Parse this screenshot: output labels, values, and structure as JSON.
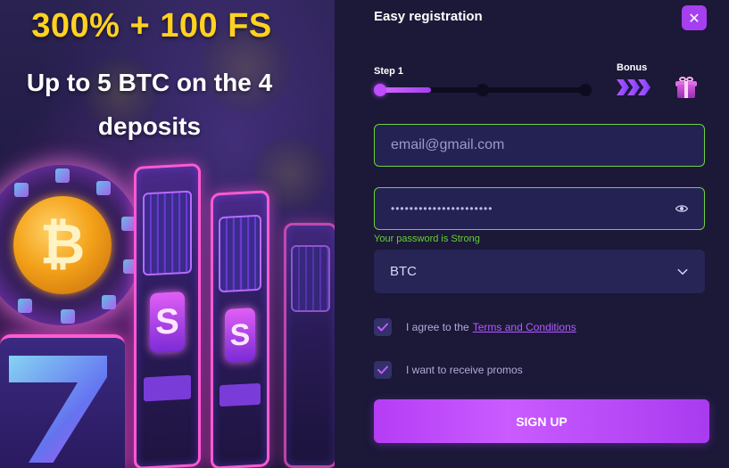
{
  "promo": {
    "headline": "300% + 100 FS",
    "subline": "Up to 5 BTC on the 4 deposits",
    "coin_symbol": "₿",
    "slot_symbol": "S",
    "colors": {
      "headline": "#ffd21f",
      "neon": "#ff5ad2",
      "coin": "#f4a21a"
    }
  },
  "form": {
    "title": "Easy registration",
    "close_icon": "close-icon",
    "close_glyph": "✕",
    "progress": {
      "step_label": "Step 1",
      "bonus_label": "Bonus",
      "current_step": 1,
      "total_steps": 3,
      "fill_fraction": 0.25
    },
    "email": {
      "placeholder": "email@gmail.com",
      "value": ""
    },
    "password": {
      "value": "••••••••••••••••••••••",
      "hint": "Your password is Strong",
      "icon": "eye-icon"
    },
    "currency": {
      "selected": "BTC",
      "icon": "chevron-down-icon"
    },
    "terms": {
      "prefix": "I agree to the",
      "link": "Terms and Conditions",
      "checked": true
    },
    "promos": {
      "label": "I want to receive promos",
      "checked": true
    },
    "submit_label": "SIGN UP",
    "colors": {
      "accent": "#a63ff0",
      "valid_border": "#6fd23d",
      "hint": "#63d13a"
    }
  }
}
